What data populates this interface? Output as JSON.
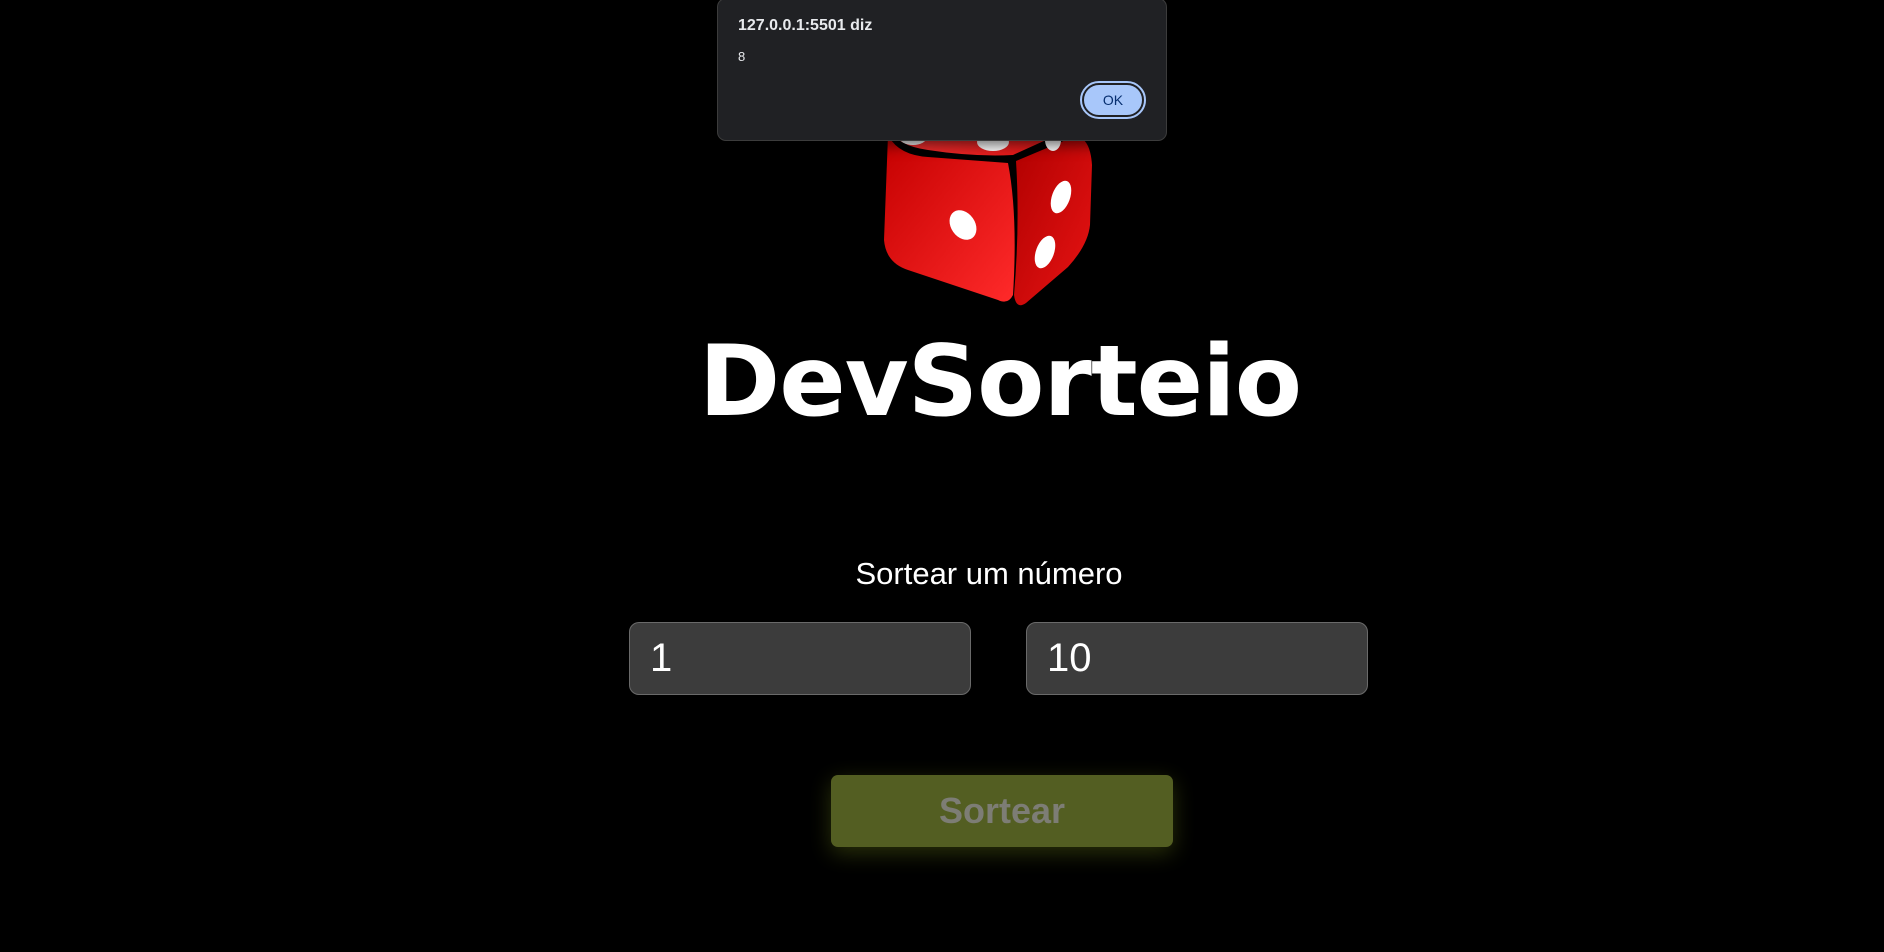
{
  "app": {
    "title": "DevSorteio",
    "subtitle": "Sortear um número",
    "logo_icon": "dice-icon",
    "accent_color": "#535e22"
  },
  "form": {
    "min_value": "1",
    "max_value": "10",
    "draw_button_label": "Sortear"
  },
  "alert": {
    "title": "127.0.0.1:5501 diz",
    "message": "8",
    "ok_label": "OK",
    "ok_color": "#a8c7fa"
  }
}
